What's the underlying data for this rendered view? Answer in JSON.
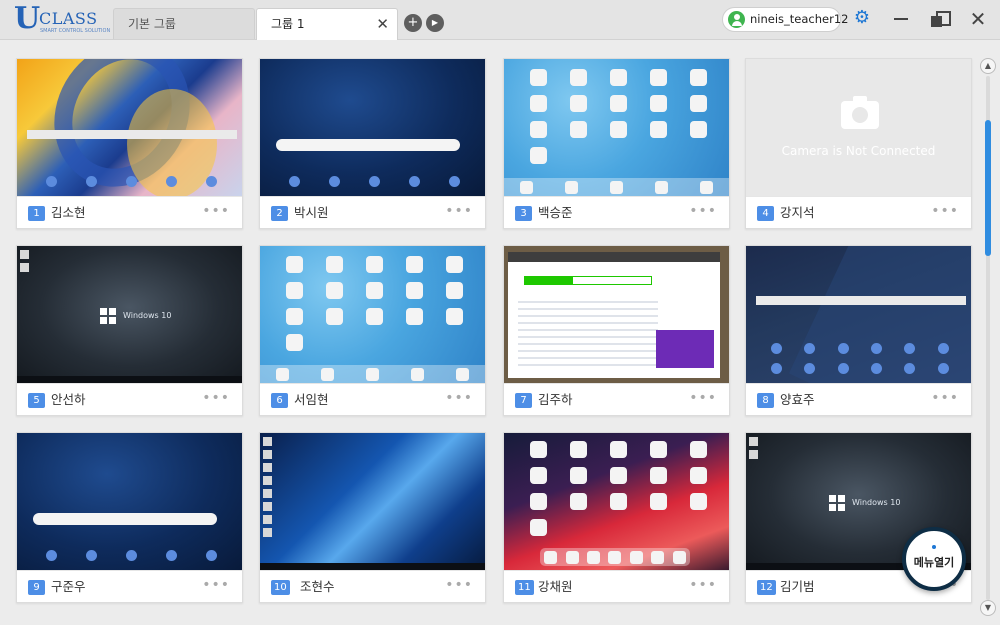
{
  "app": {
    "logo_letter": "U",
    "logo_word": "CLASS",
    "logo_sub": "SMART CONTROL SOLUTION"
  },
  "tabs": [
    {
      "label": "기본 그룹",
      "active": false
    },
    {
      "label": "그룹 1",
      "active": true
    }
  ],
  "tab_close_glyph": "✕",
  "add_tab_glyph": "+",
  "play_glyph": "▶",
  "user": {
    "name": "nineis_teacher12"
  },
  "window_controls": {
    "close_glyph": "✕"
  },
  "devices": [
    {
      "number": "1",
      "name": "김소현",
      "screen": "samsung-art"
    },
    {
      "number": "2",
      "name": "박시원",
      "screen": "android-blue"
    },
    {
      "number": "3",
      "name": "백승준",
      "screen": "ios"
    },
    {
      "number": "4",
      "name": "강지석",
      "screen": "camera-off",
      "screen_text": "Camera is Not Connected"
    },
    {
      "number": "5",
      "name": "안선하",
      "screen": "win10-dark",
      "screen_text": "Windows 10"
    },
    {
      "number": "6",
      "name": "서임현",
      "screen": "ios"
    },
    {
      "number": "7",
      "name": "김주하",
      "screen": "browser"
    },
    {
      "number": "8",
      "name": "양효주",
      "screen": "samsung-dark"
    },
    {
      "number": "9",
      "name": "구준우",
      "screen": "android-blue"
    },
    {
      "number": "10",
      "name": "조현수",
      "screen": "win10-blue"
    },
    {
      "number": "11",
      "name": "강채원",
      "screen": "ios-red"
    },
    {
      "number": "12",
      "name": "김기범",
      "screen": "win10-dark",
      "screen_text": "Windows 10"
    }
  ],
  "more_glyph": "•••",
  "scroll": {
    "up_glyph": "▲",
    "down_glyph": "▼"
  },
  "menu_button": {
    "label": "메뉴열기"
  },
  "colors": {
    "accent": "#1d77d4",
    "number_badge": "#4d8ee6",
    "online_avatar": "#3fb54f"
  }
}
